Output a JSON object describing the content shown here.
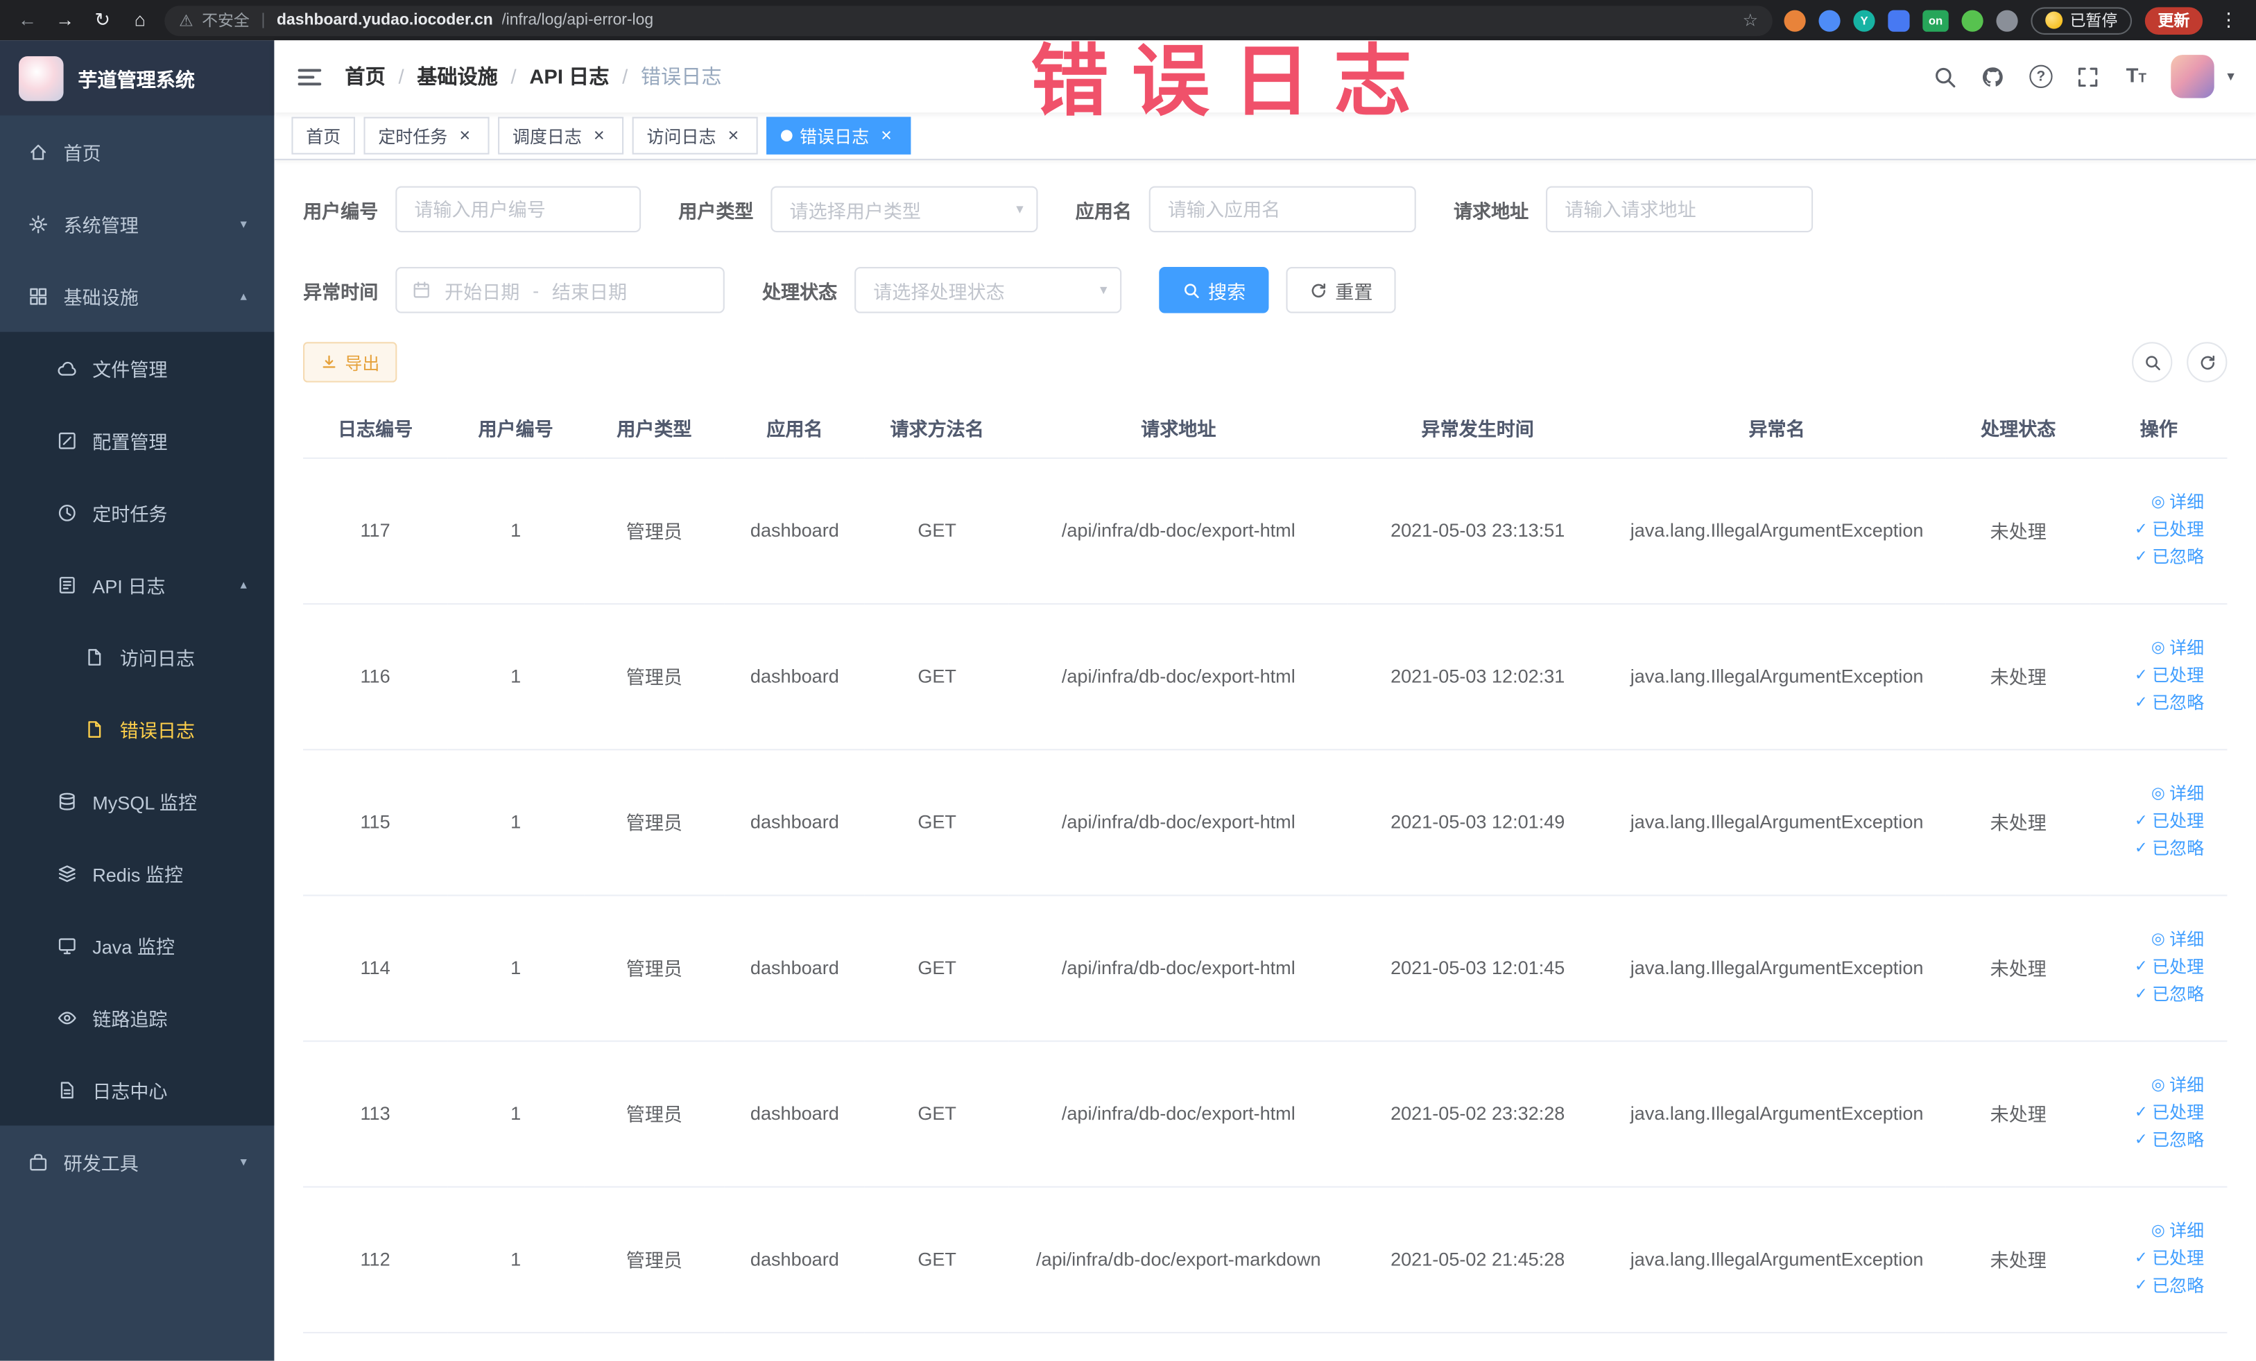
{
  "browser": {
    "security_label": "不安全",
    "url_host": "dashboard.yudao.iocoder.cn",
    "url_path": "/infra/log/api-error-log",
    "paused_label": "已暂停",
    "update_label": "更新"
  },
  "watermark": "错误日志",
  "icons": {
    "back": "←",
    "forward": "→",
    "reload": "↻",
    "home": "⌂",
    "warning": "⚠",
    "divider": "|",
    "star": "☆",
    "dots_menu": "⋮",
    "caret_down": "▾",
    "chevron_up": "▴",
    "chevron_down": "▾",
    "close": "×",
    "question": "?",
    "breadcrumb_sep": "/",
    "font_big": "T",
    "font_small": "T",
    "ext_on": "on",
    "ext_y": "Y"
  },
  "sidebar": {
    "title": "芋道管理系统",
    "items": {
      "home": "首页",
      "system": "系统管理",
      "infra": "基础设施",
      "file": "文件管理",
      "config": "配置管理",
      "job": "定时任务",
      "api_log": "API 日志",
      "access_log": "访问日志",
      "error_log": "错误日志",
      "mysql": "MySQL 监控",
      "redis": "Redis 监控",
      "java": "Java 监控",
      "trace": "链路追踪",
      "log_center": "日志中心",
      "dev_tools": "研发工具"
    }
  },
  "breadcrumb": [
    "首页",
    "基础设施",
    "API 日志",
    "错误日志"
  ],
  "tabs": [
    {
      "label": "首页",
      "closable": false,
      "active": false
    },
    {
      "label": "定时任务",
      "closable": true,
      "active": false
    },
    {
      "label": "调度日志",
      "closable": true,
      "active": false
    },
    {
      "label": "访问日志",
      "closable": true,
      "active": false
    },
    {
      "label": "错误日志",
      "closable": true,
      "active": true
    }
  ],
  "filters": {
    "user_id_label": "用户编号",
    "user_id_placeholder": "请输入用户编号",
    "user_type_label": "用户类型",
    "user_type_placeholder": "请选择用户类型",
    "app_name_label": "应用名",
    "app_name_placeholder": "请输入应用名",
    "request_url_label": "请求地址",
    "request_url_placeholder": "请输入请求地址",
    "exception_time_label": "异常时间",
    "start_date_placeholder": "开始日期",
    "date_separator": "-",
    "end_date_placeholder": "结束日期",
    "process_status_label": "处理状态",
    "process_status_placeholder": "请选择处理状态",
    "search_label": "搜索",
    "reset_label": "重置"
  },
  "toolbar": {
    "export_label": "导出"
  },
  "table": {
    "columns": [
      "日志编号",
      "用户编号",
      "用户类型",
      "应用名",
      "请求方法名",
      "请求地址",
      "异常发生时间",
      "异常名",
      "处理状态",
      "操作"
    ],
    "column_keys": [
      "log_id",
      "user_id",
      "user_type",
      "app_name",
      "method",
      "url",
      "time",
      "exception",
      "status"
    ],
    "rows": [
      {
        "log_id": "117",
        "user_id": "1",
        "user_type": "管理员",
        "app_name": "dashboard",
        "method": "GET",
        "url": "/api/infra/db-doc/export-html",
        "time": "2021-05-03 23:13:51",
        "exception": "java.lang.IllegalArgumentException",
        "status": "未处理"
      },
      {
        "log_id": "116",
        "user_id": "1",
        "user_type": "管理员",
        "app_name": "dashboard",
        "method": "GET",
        "url": "/api/infra/db-doc/export-html",
        "time": "2021-05-03 12:02:31",
        "exception": "java.lang.IllegalArgumentException",
        "status": "未处理"
      },
      {
        "log_id": "115",
        "user_id": "1",
        "user_type": "管理员",
        "app_name": "dashboard",
        "method": "GET",
        "url": "/api/infra/db-doc/export-html",
        "time": "2021-05-03 12:01:49",
        "exception": "java.lang.IllegalArgumentException",
        "status": "未处理"
      },
      {
        "log_id": "114",
        "user_id": "1",
        "user_type": "管理员",
        "app_name": "dashboard",
        "method": "GET",
        "url": "/api/infra/db-doc/export-html",
        "time": "2021-05-03 12:01:45",
        "exception": "java.lang.IllegalArgumentException",
        "status": "未处理"
      },
      {
        "log_id": "113",
        "user_id": "1",
        "user_type": "管理员",
        "app_name": "dashboard",
        "method": "GET",
        "url": "/api/infra/db-doc/export-html",
        "time": "2021-05-02 23:32:28",
        "exception": "java.lang.IllegalArgumentException",
        "status": "未处理"
      },
      {
        "log_id": "112",
        "user_id": "1",
        "user_type": "管理员",
        "app_name": "dashboard",
        "method": "GET",
        "url": "/api/infra/db-doc/export-markdown",
        "time": "2021-05-02 21:45:28",
        "exception": "java.lang.IllegalArgumentException",
        "status": "未处理"
      }
    ],
    "actions": [
      {
        "key": "detail",
        "label": "详细",
        "icon": "◎"
      },
      {
        "key": "processed",
        "label": "已处理",
        "icon": "✓"
      },
      {
        "key": "ignored",
        "label": "已忽略",
        "icon": "✓"
      }
    ]
  }
}
